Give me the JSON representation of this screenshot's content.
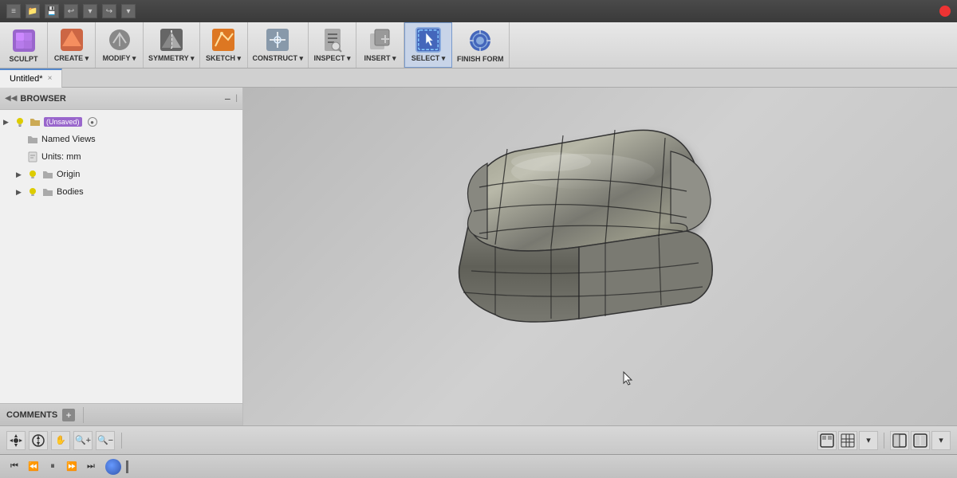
{
  "titlebar": {
    "buttons": [
      "≡",
      "📁",
      "💾",
      "↩",
      "↪"
    ],
    "recording_label": "●"
  },
  "toolbar": {
    "items": [
      {
        "id": "sculpt",
        "label": "SCULPT",
        "has_arrow": false
      },
      {
        "id": "create",
        "label": "CREATE",
        "has_arrow": true
      },
      {
        "id": "modify",
        "label": "MODIFY",
        "has_arrow": true
      },
      {
        "id": "symmetry",
        "label": "SYMMETRY",
        "has_arrow": true
      },
      {
        "id": "sketch",
        "label": "SKETCH",
        "has_arrow": true
      },
      {
        "id": "construct",
        "label": "CONSTRUCT",
        "has_arrow": true
      },
      {
        "id": "inspect",
        "label": "INSPECT",
        "has_arrow": true
      },
      {
        "id": "insert",
        "label": "INSERT",
        "has_arrow": true
      },
      {
        "id": "select",
        "label": "SELECT",
        "has_arrow": true
      },
      {
        "id": "finish",
        "label": "FINISH FORM",
        "has_arrow": false
      }
    ]
  },
  "tab": {
    "title": "Untitled*",
    "close_label": "×"
  },
  "browser": {
    "title": "BROWSER",
    "collapse_label": "−",
    "tree": [
      {
        "indent": 0,
        "has_arrow": true,
        "icon": "bulb",
        "label": "(Unsaved)",
        "has_pin": true
      },
      {
        "indent": 1,
        "has_arrow": false,
        "icon": "folder",
        "label": "Named Views"
      },
      {
        "indent": 1,
        "has_arrow": false,
        "icon": "doc",
        "label": "Units: mm"
      },
      {
        "indent": 1,
        "has_arrow": true,
        "icon": "bulb",
        "second_icon": "folder",
        "label": "Origin"
      },
      {
        "indent": 1,
        "has_arrow": true,
        "icon": "bulb",
        "second_icon": "folder",
        "label": "Bodies"
      }
    ]
  },
  "comments": {
    "label": "COMMENTS",
    "add_label": "+"
  },
  "playbar": {
    "buttons": [
      "⏮",
      "⏪",
      "⏸",
      "⏩",
      "⏭"
    ]
  },
  "bottom_toolbar": {
    "left_buttons": [
      "⊕",
      "⬡",
      "✋",
      "⊕",
      "⊖"
    ],
    "right_groups": [
      [
        "▣",
        "⊞"
      ],
      [
        "⊟",
        "⊞",
        "⊠"
      ]
    ]
  },
  "colors": {
    "accent": "#5588cc",
    "toolbar_bg": "#e0e0e0",
    "sidebar_bg": "#f0f0f0",
    "viewport_bg": "#c8c8c8"
  }
}
